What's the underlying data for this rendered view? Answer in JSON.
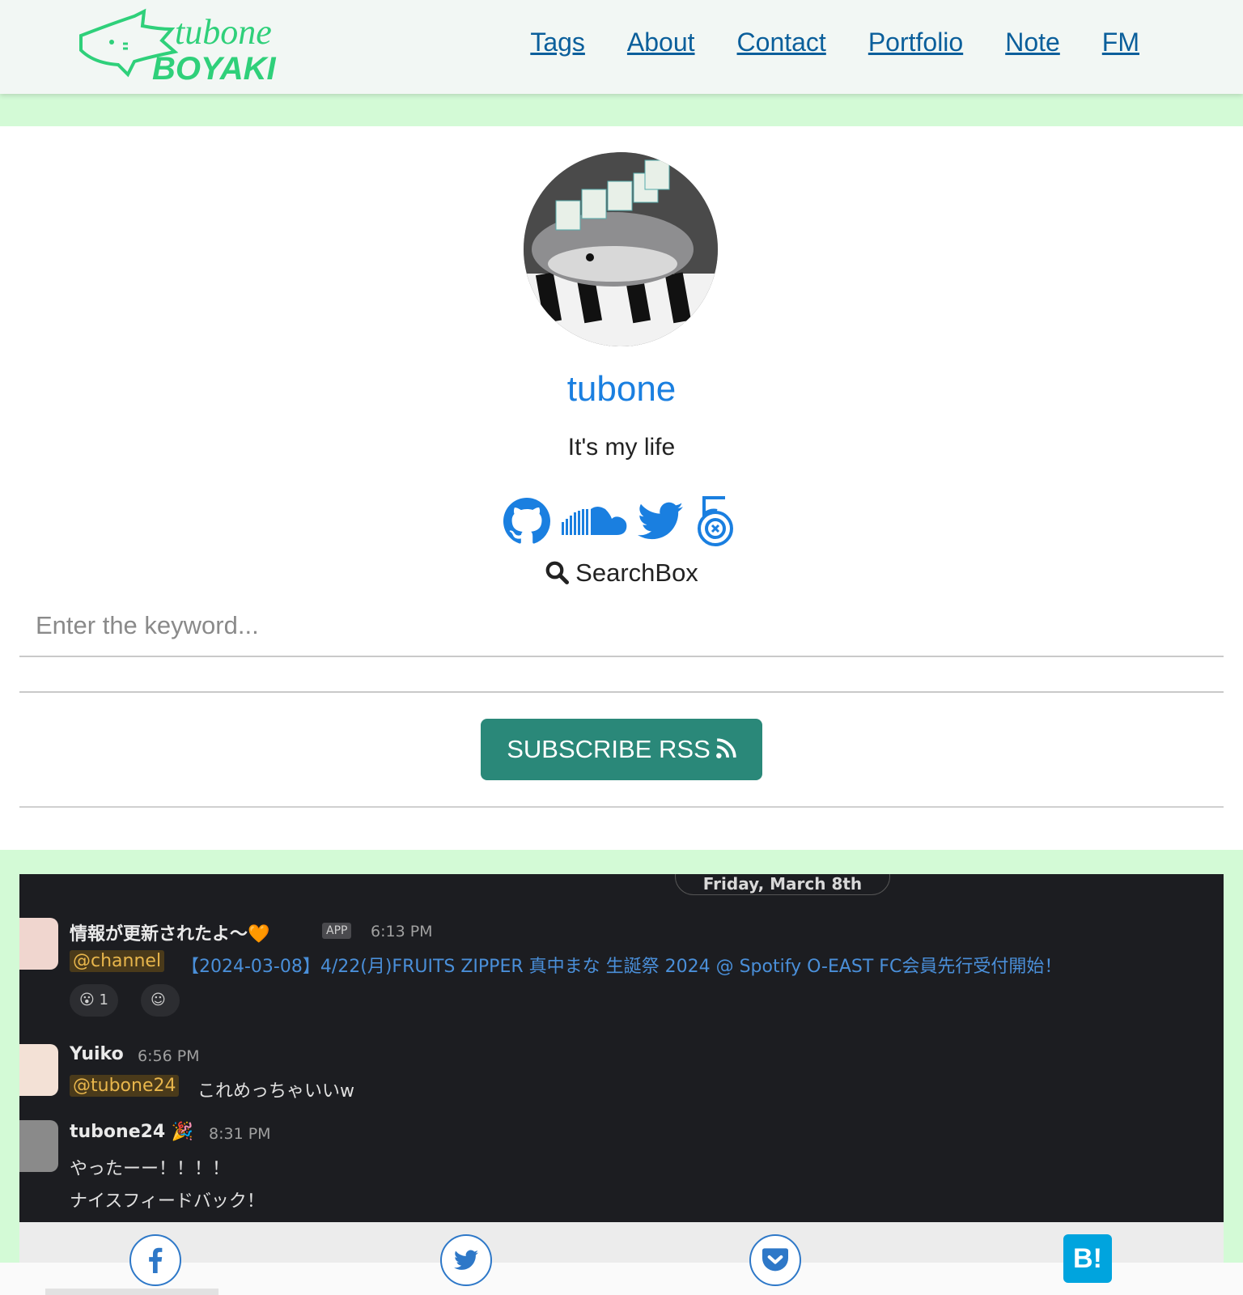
{
  "header": {
    "logo_text_top": "tubone",
    "logo_text_bottom": "BOYAKI",
    "nav": [
      "Tags",
      "About",
      "Contact",
      "Portfolio",
      "Note",
      "FM"
    ]
  },
  "profile": {
    "name": "tubone",
    "tagline": "It's my life",
    "socials": [
      "github-icon",
      "soundcloud-icon",
      "twitter-icon",
      "500px-icon"
    ]
  },
  "search": {
    "title": "SearchBox",
    "placeholder": "Enter the keyword..."
  },
  "rss": {
    "label": "SUBSCRIBE RSS"
  },
  "post_image": {
    "date": "Friday, March 8th",
    "messages": [
      {
        "name": "情報が更新されたよ〜🧡",
        "badge": "APP",
        "time": "6:13 PM",
        "mention": "@channel",
        "text": "【2024-03-08】4/22(月)FRUITS ZIPPER 真中まな 生誕祭 2024 @ Spotify O-EAST FC会員先行受付開始！",
        "reaction": "😮 1"
      },
      {
        "name": "Yuiko",
        "time": "6:56 PM",
        "mention": "@tubone24",
        "text": "これめっちゃいいw"
      },
      {
        "name": "tubone24 🎉",
        "time": "8:31 PM",
        "text_line1": "やったーー！！！！",
        "text_line2": "ナイスフィードバック！"
      }
    ]
  },
  "share": {
    "buttons": [
      "facebook-icon",
      "twitter-icon",
      "pocket-icon"
    ],
    "hatena_label": "B!"
  },
  "colors": {
    "brand_green": "#2fd07a",
    "nav_link": "#0b5f9b",
    "name_blue": "#1a7fe0",
    "rss_button": "#2a8879",
    "page_bg": "#d3fad6"
  }
}
